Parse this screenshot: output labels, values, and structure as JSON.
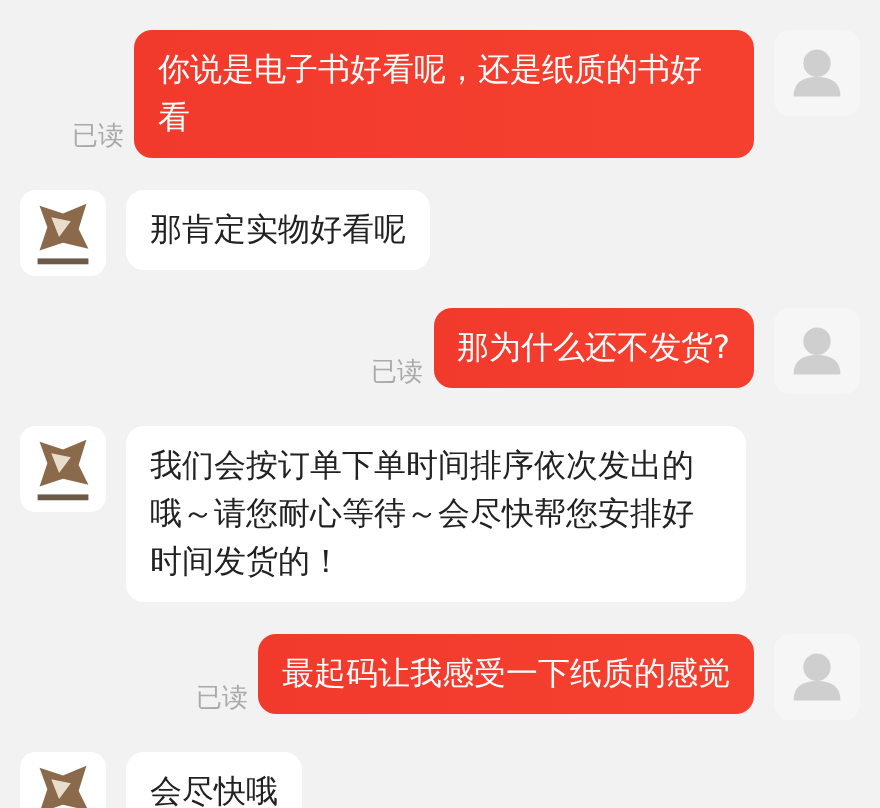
{
  "messages": [
    {
      "kind": "sent",
      "text": "你说是电子书好看呢，还是纸质的书好看",
      "receipt": "已读"
    },
    {
      "kind": "received",
      "text": "那肯定实物好看呢"
    },
    {
      "kind": "sent",
      "text": "那为什么还不发货?",
      "receipt": "已读"
    },
    {
      "kind": "received",
      "text": "我们会按订单下单时间排序依次发出的哦～请您耐心等待～会尽快帮您安排好时间发货的！"
    },
    {
      "kind": "sent",
      "text": "最起码让我感受一下纸质的感觉",
      "receipt": "已读"
    },
    {
      "kind": "received",
      "text": "会尽快哦"
    }
  ]
}
